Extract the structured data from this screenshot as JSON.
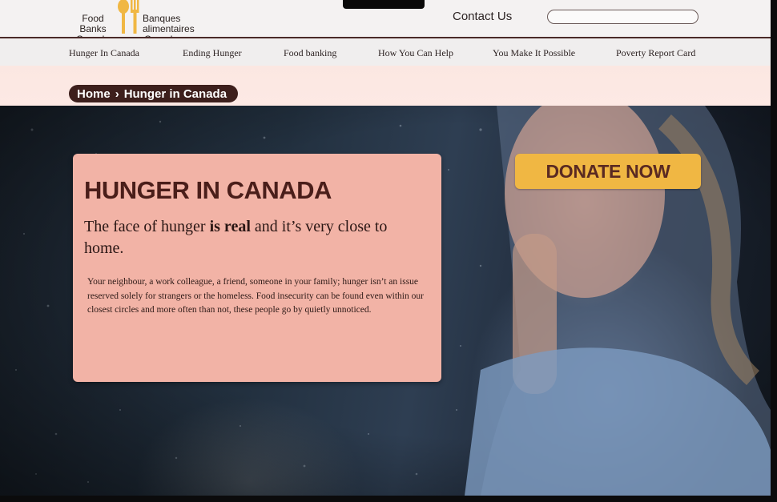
{
  "header": {
    "logo": {
      "en_line1": "Food Banks",
      "en_line2": "Canada",
      "fr_line1": "Banques alimentaires",
      "fr_line2": "Canada",
      "icon": "fork-spoon-logo-icon",
      "accent": "#f0b743"
    },
    "contact_label": "Contact Us",
    "search": {
      "value": "",
      "placeholder": ""
    }
  },
  "nav": {
    "items": [
      {
        "label": "Hunger In Canada"
      },
      {
        "label": "Ending Hunger"
      },
      {
        "label": "Food banking"
      },
      {
        "label": "How You Can Help"
      },
      {
        "label": "You Make It Possible"
      },
      {
        "label": "Poverty Report Card"
      }
    ]
  },
  "breadcrumb": {
    "home": "Home",
    "separator_icon": "chevron-right-icon",
    "current": "Hunger in Canada"
  },
  "hero": {
    "title": "HUNGER IN CANADA",
    "lead_pre": "The face of hunger ",
    "lead_bold": "is real",
    "lead_post": " and it’s very close to home.",
    "body": "Your neighbour, a work colleague, a friend, someone in your family; hunger isn’t an issue reserved solely for strangers or the homeless. Food insecurity can be found even within our closest circles and more often than not, these people go by quietly unnoticed.",
    "card_color": "#f2b3a6",
    "title_color": "#4a1e1a"
  },
  "donate": {
    "label": "DONATE NOW",
    "color": "#f0b743"
  }
}
